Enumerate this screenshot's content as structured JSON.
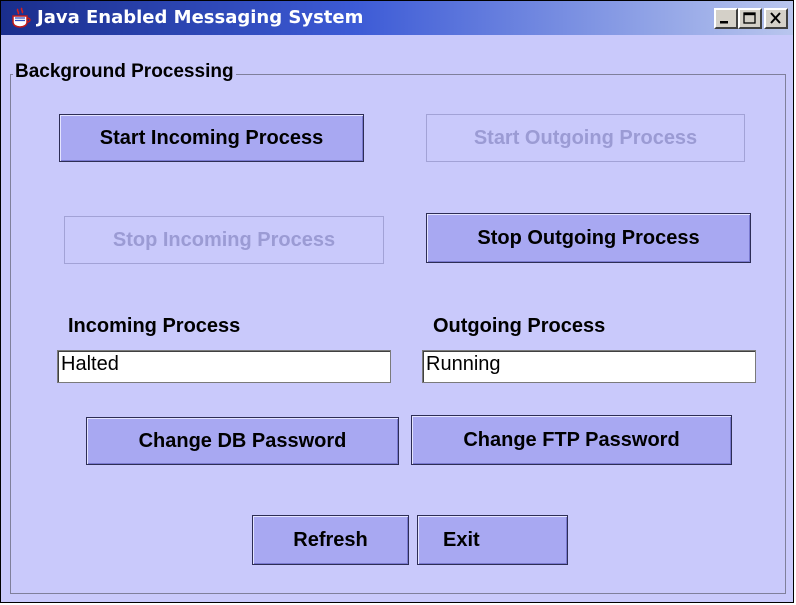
{
  "window": {
    "title": "Java Enabled Messaging System",
    "app_icon": "java-cup-icon",
    "controls": [
      {
        "name": "minimize-button",
        "glyph": "_"
      },
      {
        "name": "maximize-button",
        "glyph": "□"
      },
      {
        "name": "close-button",
        "glyph": "×"
      }
    ]
  },
  "group": {
    "title": "Background Processing"
  },
  "buttons": {
    "start_incoming": {
      "label": "Start Incoming Process",
      "enabled": true
    },
    "start_outgoing": {
      "label": "Start Outgoing Process",
      "enabled": false
    },
    "stop_incoming": {
      "label": "Stop Incoming Process",
      "enabled": false
    },
    "stop_outgoing": {
      "label": "Stop Outgoing Process",
      "enabled": true
    },
    "change_db_password": {
      "label": "Change DB Password",
      "enabled": true
    },
    "change_ftp_password": {
      "label": "Change FTP Password",
      "enabled": true
    },
    "refresh": {
      "label": "Refresh",
      "enabled": true
    },
    "exit": {
      "label": "Exit",
      "enabled": true
    }
  },
  "status": {
    "incoming": {
      "label": "Incoming Process",
      "value": "Halted"
    },
    "outgoing": {
      "label": "Outgoing Process",
      "value": "Running"
    }
  },
  "colors": {
    "background": "#c9c9fb",
    "button": "#a8a8f2",
    "disabled_text": "#9b9bd4",
    "titlebar_start": "#1a2e8c",
    "titlebar_end": "#b9c6ee"
  }
}
